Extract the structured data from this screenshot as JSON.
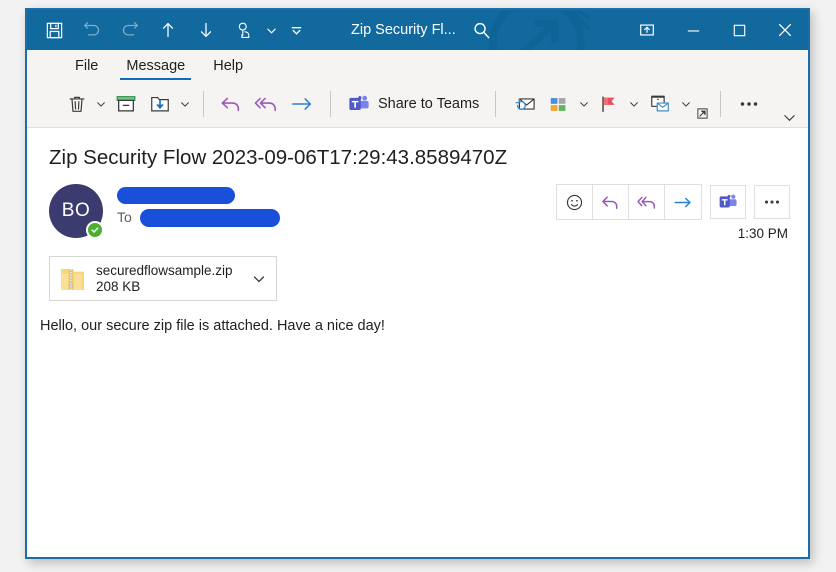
{
  "window": {
    "title": "Zip Security Fl...",
    "accent_color": "#11699e",
    "border_color": "#1b6ea8"
  },
  "quick_access_toolbar": {
    "items": [
      {
        "name": "save-button",
        "icon": "save-icon",
        "enabled": true
      },
      {
        "name": "undo-button",
        "icon": "undo-icon",
        "enabled": false
      },
      {
        "name": "redo-button",
        "icon": "redo-icon",
        "enabled": false
      },
      {
        "name": "previous-item-button",
        "icon": "arrow-up-icon",
        "enabled": true
      },
      {
        "name": "next-item-button",
        "icon": "arrow-down-icon",
        "enabled": true
      },
      {
        "name": "touch-mouse-mode-button",
        "icon": "touch-mode-icon",
        "enabled": true
      }
    ]
  },
  "titlebar_buttons": {
    "search_label": "Search",
    "restore_down_label": "Restore Down",
    "minimize_label": "Minimize",
    "maximize_label": "Maximize",
    "close_label": "Close"
  },
  "ribbon": {
    "tabs": [
      {
        "label": "File",
        "active": false
      },
      {
        "label": "Message",
        "active": true
      },
      {
        "label": "Help",
        "active": false
      }
    ],
    "active_tab_underline_color": "#0f6cbd",
    "commands": [
      {
        "name": "delete-button",
        "icon": "trash-icon",
        "label": "Delete",
        "has_caret": true
      },
      {
        "name": "archive-button",
        "icon": "archive-icon",
        "label": "Archive",
        "has_caret": false
      },
      {
        "name": "move-button",
        "icon": "move-to-folder-icon",
        "label": "Move",
        "has_caret": true
      },
      {
        "name": "reply-button",
        "icon": "reply-icon",
        "label": "Reply",
        "has_caret": false
      },
      {
        "name": "reply-all-button",
        "icon": "reply-all-icon",
        "label": "Reply All",
        "has_caret": false
      },
      {
        "name": "forward-button",
        "icon": "forward-icon",
        "label": "Forward",
        "has_caret": false
      },
      {
        "name": "share-to-teams-button",
        "icon": "teams-icon",
        "label": "Share to Teams",
        "has_caret": false
      },
      {
        "name": "mark-unread-button",
        "icon": "mark-unread-icon",
        "label": "Mark Unread",
        "has_caret": false
      },
      {
        "name": "categorize-button",
        "icon": "categorize-icon",
        "label": "Categorize",
        "has_caret": true
      },
      {
        "name": "follow-up-button",
        "icon": "flag-icon",
        "label": "Follow Up",
        "has_caret": true
      },
      {
        "name": "rules-button",
        "icon": "rules-icon",
        "label": "Rules",
        "has_caret": true
      },
      {
        "name": "more-commands-button",
        "icon": "ellipsis-icon",
        "label": "More Commands",
        "has_caret": false
      }
    ],
    "share_to_teams_label": "Share to Teams",
    "dialog_launcher_label": "Tags dialog launcher",
    "overflow_label": "Ribbon options"
  },
  "message": {
    "subject": "Zip Security Flow 2023-09-06T17:29:43.8589470Z",
    "sender": {
      "avatar_initials": "BO",
      "avatar_color": "#3b3b70",
      "presence_color": "#4caf2f",
      "presence_status": "available",
      "name_redacted": true,
      "redaction_color": "#1a4fdb"
    },
    "to_label": "To",
    "to_redacted": true,
    "timestamp": "1:30 PM",
    "body": "Hello, our secure zip file is attached. Have a nice day!",
    "attachment": {
      "filename": "securedflowsample.zip",
      "size": "208 KB",
      "icon": "zip-file-icon",
      "caret_label": "Attachment options"
    },
    "actions": [
      {
        "name": "react-button",
        "icon": "smiley-icon",
        "label": "React"
      },
      {
        "name": "reply-button",
        "icon": "reply-icon",
        "label": "Reply"
      },
      {
        "name": "reply-all-button",
        "icon": "reply-all-icon",
        "label": "Reply All"
      },
      {
        "name": "forward-button",
        "icon": "forward-icon",
        "label": "Forward"
      },
      {
        "name": "teams-button",
        "icon": "teams-icon",
        "label": "Share to Teams"
      },
      {
        "name": "more-actions-button",
        "icon": "ellipsis-icon",
        "label": "More actions"
      }
    ]
  }
}
